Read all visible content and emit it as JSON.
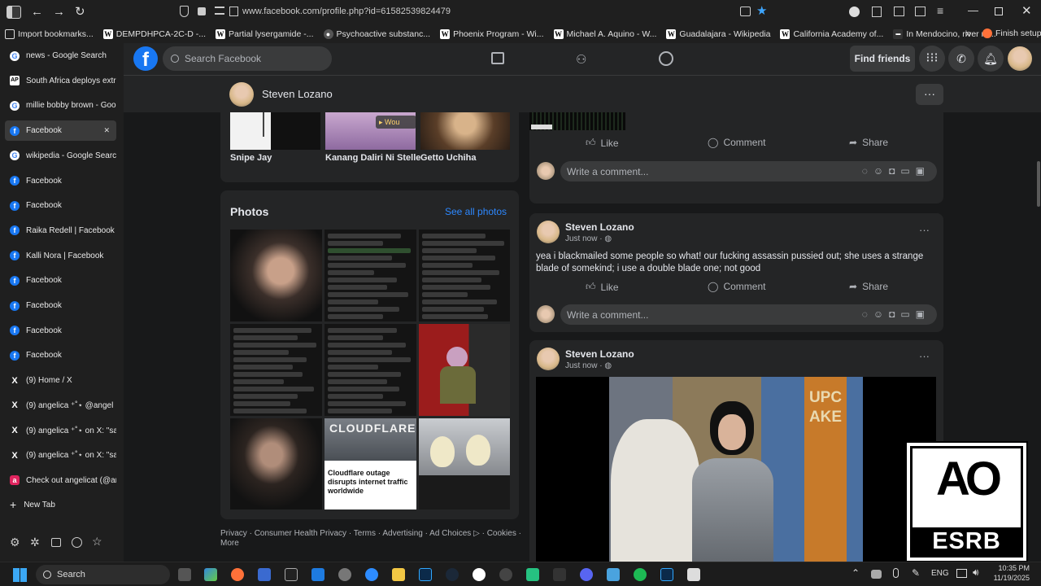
{
  "browser": {
    "url": "www.facebook.com/profile.php?id=61582539824479",
    "bookmarks": [
      "Import bookmarks...",
      "DEMPDHPCA-2C-D -...",
      "Partial lysergamide -...",
      "Psychoactive substanc...",
      "Phoenix Program - Wi...",
      "Michael A. Aquino - W...",
      "Guadalajara - Wikipedia",
      "California Academy of...",
      "In Mendocino, river re...",
      "Finish setup"
    ],
    "bookmark_icons": [
      "import-icon",
      "wikipedia-icon",
      "wikipedia-icon",
      "google-icon",
      "wikipedia-icon",
      "wikipedia-icon",
      "wikipedia-icon",
      "wikipedia-icon",
      "news-icon",
      "firefox-icon"
    ],
    "tabs": [
      {
        "label": "news - Google Search",
        "icon": "G",
        "kind": "g"
      },
      {
        "label": "South Africa deploys extra",
        "icon": "AP",
        "kind": "ap"
      },
      {
        "label": "millie bobby brown - Goo",
        "icon": "G",
        "kind": "g"
      },
      {
        "label": "Facebook",
        "icon": "f",
        "kind": "fb",
        "active": true
      },
      {
        "label": "wikipedia - Google Search",
        "icon": "G",
        "kind": "g"
      },
      {
        "label": "Facebook",
        "icon": "f",
        "kind": "fb"
      },
      {
        "label": "Facebook",
        "icon": "f",
        "kind": "fb"
      },
      {
        "label": "Raika Redell | Facebook",
        "icon": "f",
        "kind": "fb"
      },
      {
        "label": "Kalli Nora | Facebook",
        "icon": "f",
        "kind": "fb"
      },
      {
        "label": "Facebook",
        "icon": "f",
        "kind": "fb"
      },
      {
        "label": "Facebook",
        "icon": "f",
        "kind": "fb"
      },
      {
        "label": "Facebook",
        "icon": "f",
        "kind": "fb"
      },
      {
        "label": "Facebook",
        "icon": "f",
        "kind": "fb"
      },
      {
        "label": "(9) Home / X",
        "icon": "X",
        "kind": "x"
      },
      {
        "label": "(9) angelica ⁺˚⋆ @angel",
        "icon": "X",
        "kind": "x"
      },
      {
        "label": "(9) angelica ⁺˚⋆ on X: \"sa",
        "icon": "X",
        "kind": "x"
      },
      {
        "label": "(9) angelica ⁺˚⋆ on X: \"sa",
        "icon": "X",
        "kind": "x"
      },
      {
        "label": "Check out angelicat (@ang",
        "icon": "a",
        "kind": "ac"
      }
    ],
    "new_tab": "New Tab"
  },
  "fb": {
    "search_placeholder": "Search Facebook",
    "find_friends": "Find friends",
    "profile_name": "Steven Lozano",
    "friends": [
      "Snipe Jay",
      "Kanang Daliri Ni Stelle",
      "Getto Uchiha"
    ],
    "friend_overlay": "Wou",
    "photos_title": "Photos",
    "see_all_photos": "See all photos",
    "news_headline": "Cloudflare outage disrupts internet traffic worldwide",
    "news_logo": "CLOUDFLARE",
    "footer": [
      "Privacy",
      "Consumer Health Privacy",
      "Terms",
      "Advertising",
      "Ad Choices",
      "Cookies",
      "More"
    ],
    "like": "Like",
    "comment": "Comment",
    "share": "Share",
    "write_comment": "Write a comment...",
    "posts": [
      {
        "author": "Steven Lozano",
        "time": "Just now",
        "text": "yea i blackmailed some people so what! our fucking assassin pussied out; she uses a strange blade of somekind; i use a double blade one; not good"
      },
      {
        "author": "Steven Lozano",
        "time": "Just now",
        "text": ""
      }
    ],
    "post_image_sign": "UPCAKE"
  },
  "esrb": {
    "label": "ESRB",
    "rating": "AO"
  },
  "taskbar": {
    "search": "Search",
    "lang": "ENG",
    "time": "10:35 PM",
    "date": "11/19/2025"
  },
  "colors": {
    "fb_blue": "#1877f2",
    "link": "#2d88ff"
  }
}
